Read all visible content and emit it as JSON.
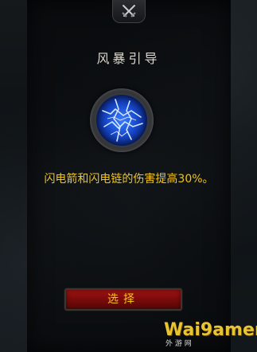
{
  "panel": {
    "title": "风暴引导",
    "description": "闪电箭和闪电链的伤害提高30%。",
    "select_label": "选择"
  },
  "icons": {
    "top_emblem": "crossed-swords-icon",
    "talent": "lightning-storm-icon"
  },
  "watermark": {
    "text": "Wai9amer",
    "sub": "外 游 网"
  },
  "colors": {
    "title": "#d9d6cf",
    "description": "#f0c41a",
    "button_red": "#8a0e0e",
    "button_text": "#f2c417",
    "lightning_blue": "#3b7cff"
  }
}
